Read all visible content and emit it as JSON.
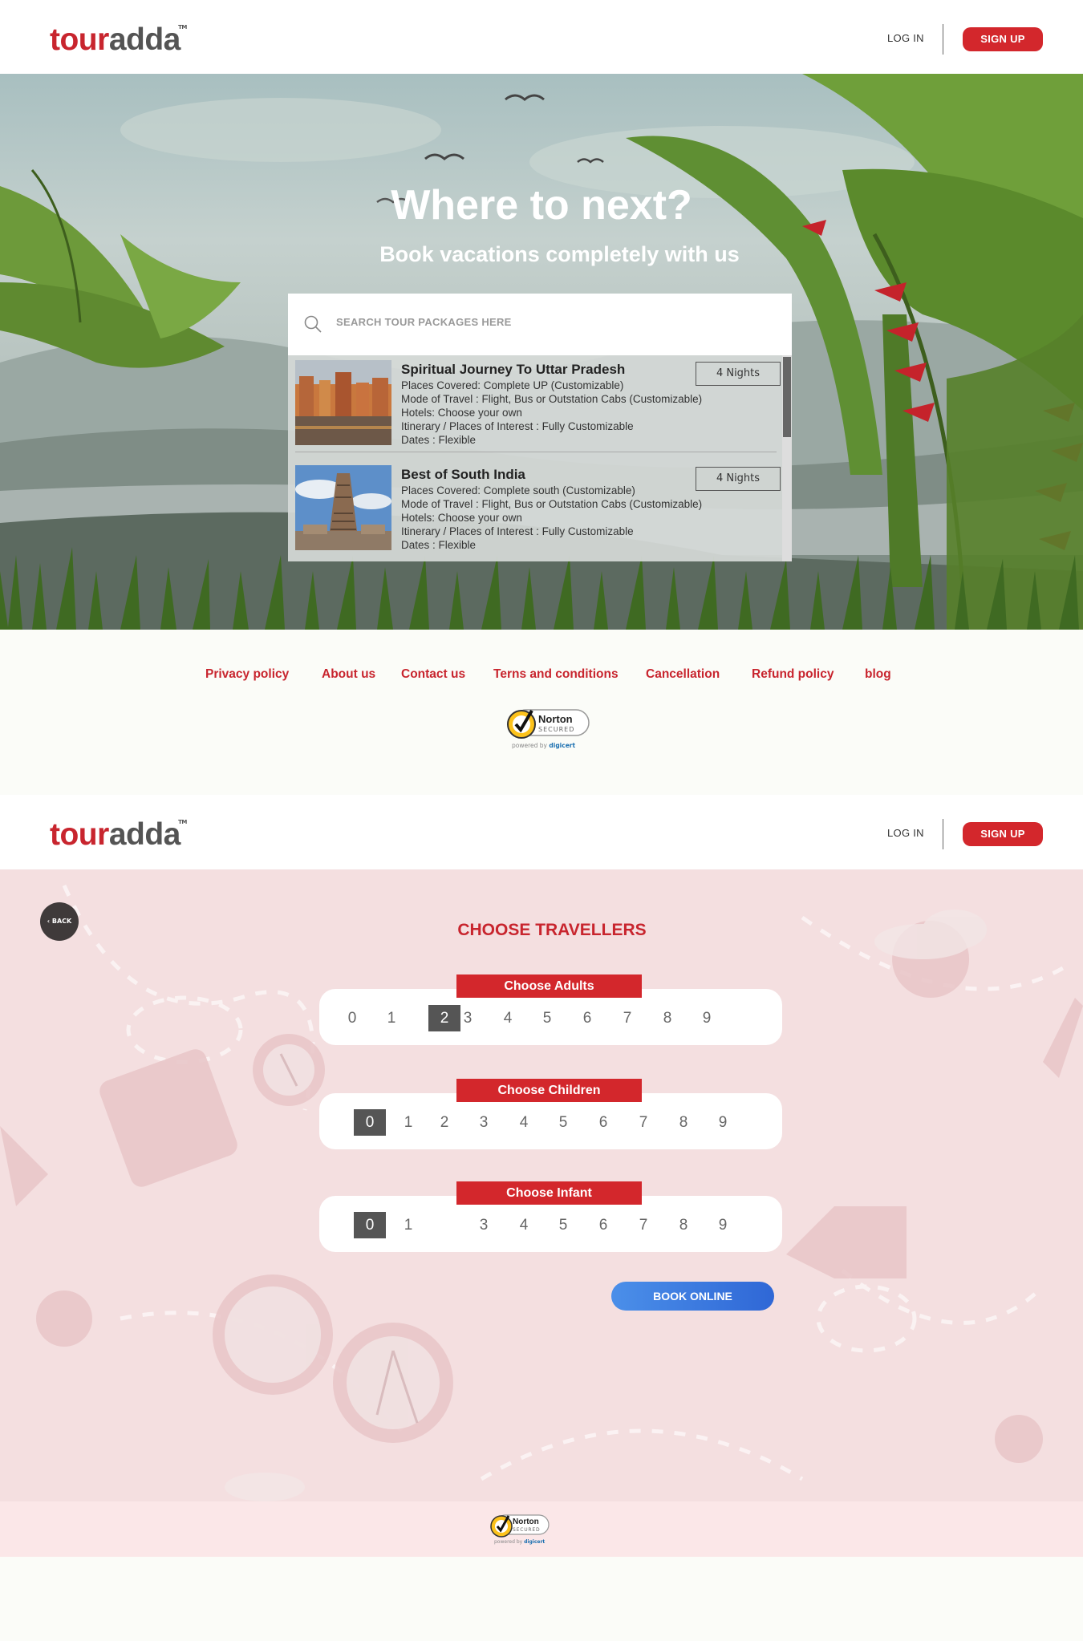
{
  "brand": {
    "part1": "tour",
    "part2": "adda",
    "tm": "TM"
  },
  "header": {
    "login": "LOG IN",
    "signup": "SIGN UP"
  },
  "hero": {
    "title": "Where to next?",
    "subtitle": "Book vacations completely with us",
    "search_placeholder": "SEARCH TOUR PACKAGES HERE"
  },
  "packages": [
    {
      "name": "Spiritual Journey To Uttar Pradesh",
      "nights": "4 Nights",
      "places": "Places Covered: Complete UP (Customizable)",
      "travel": "Mode of Travel : Flight, Bus or Outstation Cabs (Customizable)",
      "hotels": "Hotels: Choose your own",
      "itinerary": "Itinerary / Places of Interest : Fully Customizable",
      "dates": "Dates : Flexible"
    },
    {
      "name": "Best of South India",
      "nights": "4 Nights",
      "places": "Places Covered: Complete south (Customizable)",
      "travel": "Mode of Travel : Flight, Bus or Outstation Cabs (Customizable)",
      "hotels": "Hotels: Choose your own",
      "itinerary": "Itinerary / Places of Interest : Fully Customizable",
      "dates": "Dates : Flexible"
    }
  ],
  "footer_links": [
    "Privacy policy",
    "About us",
    "Contact us",
    "Terns and conditions",
    "Cancellation",
    "Refund policy",
    "blog"
  ],
  "norton": {
    "name": "Norton",
    "secured": "SECURED",
    "powered": "powered by",
    "digicert": "digicert"
  },
  "travellers": {
    "back": "‹ BACK",
    "title": "CHOOSE TRAVELLERS",
    "adults_label": "Choose Adults",
    "adults_options": [
      "0",
      "1",
      "2",
      "3",
      "4",
      "5",
      "6",
      "7",
      "8",
      "9"
    ],
    "adults_selected": "2",
    "children_label": "Choose Children",
    "children_options": [
      "0",
      "1",
      "2",
      "3",
      "4",
      "5",
      "6",
      "7",
      "8",
      "9"
    ],
    "children_selected": "0",
    "infant_label": "Choose Infant",
    "infant_options": [
      "0",
      "1",
      "3",
      "4",
      "5",
      "6",
      "7",
      "8",
      "9"
    ],
    "infant_selected": "0",
    "book": "BOOK ONLINE"
  },
  "colors": {
    "brand_red": "#c8252e",
    "button_red": "#d3272c",
    "book_blue": "#3a78e0",
    "selected_gray": "#555555"
  }
}
